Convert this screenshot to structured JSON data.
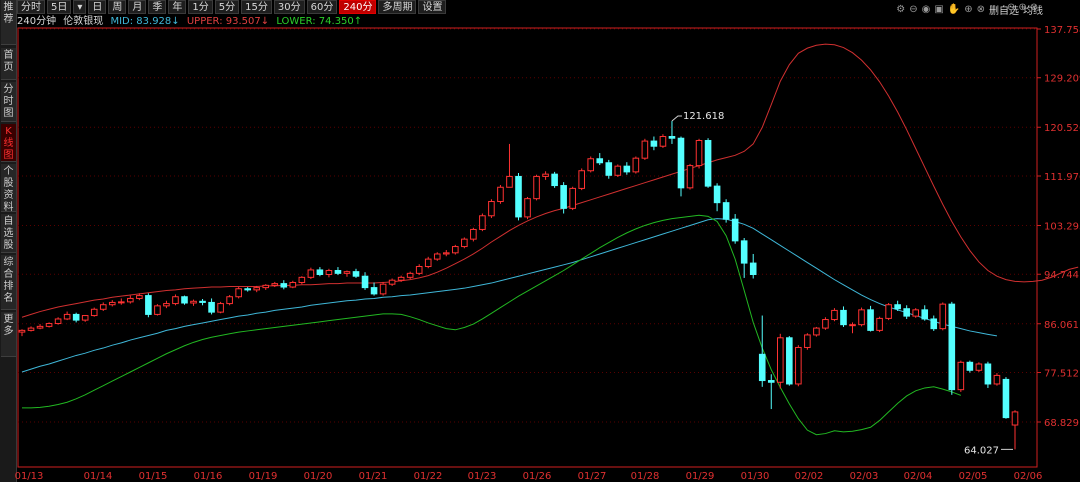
{
  "sidebar": {
    "items": [
      {
        "label": "推荐"
      },
      {
        "label": "首页"
      },
      {
        "label": "分时图"
      },
      {
        "label": "K线图",
        "active": true
      },
      {
        "label": "个股资料"
      },
      {
        "label": "自选股"
      },
      {
        "label": "综合排名"
      },
      {
        "label": "更多"
      }
    ]
  },
  "toolbar": {
    "items": [
      {
        "label": "分时"
      },
      {
        "label": "5日"
      },
      {
        "label": "▾"
      },
      {
        "label": "日"
      },
      {
        "label": "周"
      },
      {
        "label": "月"
      },
      {
        "label": "季"
      },
      {
        "label": "年"
      },
      {
        "label": "1分"
      },
      {
        "label": "5分"
      },
      {
        "label": "15分"
      },
      {
        "label": "30分"
      },
      {
        "label": "60分"
      },
      {
        "label": "240分",
        "active": true
      },
      {
        "label": "多周期"
      },
      {
        "label": "设置"
      }
    ]
  },
  "legend": {
    "period": "240分钟",
    "name": "伦敦银现",
    "mid": "MID: 83.928↓",
    "upper": "UPPER: 93.507↓",
    "lower": "LOWER: 74.350↑"
  },
  "right_tools": {
    "icons": [
      "settings-icon",
      "minus-icon",
      "eye-icon",
      "lock-icon",
      "hand-icon",
      "plus-icon",
      "close-icon"
    ],
    "labels": [
      "删自选",
      "均线"
    ],
    "right_icons": [
      "minus-icon",
      "plus-icon",
      "close-icon"
    ]
  },
  "colors": {
    "up": "#ff3232",
    "down": "#54ffff",
    "mid": "#3fb7d8",
    "upper": "#d03030",
    "lower": "#22b822",
    "axis": "#d02020"
  },
  "chart_data": {
    "type": "candlestick",
    "y_ticks": [
      "137.758",
      "129.209",
      "120.526",
      "111.976",
      "103.293",
      "94.744",
      "86.061",
      "77.512",
      "68.829"
    ],
    "x_labels": [
      "01/13",
      "01/14",
      "01/15",
      "01/16",
      "01/19",
      "01/20",
      "01/21",
      "01/22",
      "01/23",
      "01/26",
      "01/27",
      "01/28",
      "01/29",
      "01/30",
      "02/02",
      "02/03",
      "02/04",
      "02/05",
      "02/06"
    ],
    "annotations": [
      {
        "label": "121.618",
        "kind": "high"
      },
      {
        "label": "64.027",
        "kind": "low"
      }
    ],
    "candles": [
      [
        84.6,
        85.1,
        83.9,
        84.9
      ],
      [
        84.9,
        85.6,
        84.7,
        85.3
      ],
      [
        85.3,
        86.0,
        85.1,
        85.6
      ],
      [
        85.6,
        86.3,
        85.4,
        86.1
      ],
      [
        86.1,
        87.2,
        85.9,
        86.9
      ],
      [
        86.9,
        88.2,
        86.7,
        87.7
      ],
      [
        87.7,
        88.0,
        86.3,
        86.7
      ],
      [
        86.7,
        87.6,
        86.4,
        87.5
      ],
      [
        87.5,
        88.9,
        87.3,
        88.6
      ],
      [
        88.6,
        89.8,
        88.3,
        89.4
      ],
      [
        89.4,
        90.2,
        89.1,
        89.8
      ],
      [
        89.8,
        90.5,
        89.4,
        89.9
      ],
      [
        89.9,
        91.0,
        89.6,
        90.5
      ],
      [
        90.5,
        91.4,
        90.2,
        91.0
      ],
      [
        91.0,
        91.4,
        87.2,
        87.7
      ],
      [
        87.7,
        89.5,
        87.5,
        89.2
      ],
      [
        89.2,
        90.1,
        88.8,
        89.6
      ],
      [
        89.6,
        91.2,
        89.3,
        90.8
      ],
      [
        90.8,
        91.0,
        89.4,
        89.7
      ],
      [
        89.7,
        90.3,
        89.2,
        90.0
      ],
      [
        90.0,
        90.4,
        89.3,
        89.8
      ],
      [
        89.8,
        90.5,
        87.7,
        88.1
      ],
      [
        88.1,
        89.9,
        87.9,
        89.6
      ],
      [
        89.6,
        91.1,
        89.3,
        90.8
      ],
      [
        90.8,
        92.5,
        90.5,
        92.2
      ],
      [
        92.2,
        92.5,
        91.7,
        92.0
      ],
      [
        92.0,
        92.7,
        91.6,
        92.4
      ],
      [
        92.4,
        93.0,
        92.0,
        92.8
      ],
      [
        92.8,
        93.4,
        92.5,
        93.1
      ],
      [
        93.1,
        93.7,
        92.1,
        92.5
      ],
      [
        92.5,
        93.6,
        92.3,
        93.3
      ],
      [
        93.3,
        94.4,
        93.0,
        94.2
      ],
      [
        94.2,
        95.9,
        93.9,
        95.5
      ],
      [
        95.5,
        96.0,
        94.4,
        94.7
      ],
      [
        94.7,
        95.7,
        94.2,
        95.4
      ],
      [
        95.4,
        96.0,
        94.6,
        94.9
      ],
      [
        94.9,
        95.4,
        94.3,
        95.2
      ],
      [
        95.2,
        95.7,
        94.1,
        94.4
      ],
      [
        94.4,
        95.1,
        92.0,
        92.4
      ],
      [
        92.4,
        93.3,
        91.0,
        91.3
      ],
      [
        91.3,
        93.4,
        91.0,
        93.0
      ],
      [
        93.0,
        94.0,
        92.7,
        93.7
      ],
      [
        93.7,
        94.5,
        93.4,
        94.2
      ],
      [
        94.2,
        95.2,
        93.9,
        94.9
      ],
      [
        94.9,
        96.5,
        94.6,
        96.1
      ],
      [
        96.1,
        97.8,
        95.8,
        97.4
      ],
      [
        97.4,
        98.6,
        97.1,
        98.3
      ],
      [
        98.3,
        99.0,
        97.9,
        98.5
      ],
      [
        98.5,
        99.9,
        98.2,
        99.6
      ],
      [
        99.6,
        101.2,
        99.3,
        100.9
      ],
      [
        100.9,
        102.9,
        100.5,
        102.6
      ],
      [
        102.6,
        105.4,
        102.3,
        105.0
      ],
      [
        105.0,
        107.9,
        104.6,
        107.5
      ],
      [
        107.5,
        110.4,
        107.1,
        110.0
      ],
      [
        110.0,
        117.6,
        110.6,
        111.9
      ],
      [
        111.9,
        112.5,
        104.2,
        104.8
      ],
      [
        104.8,
        108.3,
        104.4,
        108.0
      ],
      [
        108.0,
        112.2,
        107.7,
        111.9
      ],
      [
        111.9,
        112.8,
        111.3,
        112.3
      ],
      [
        112.3,
        112.7,
        109.9,
        110.3
      ],
      [
        110.3,
        110.9,
        105.4,
        106.3
      ],
      [
        106.3,
        110.1,
        106.0,
        109.8
      ],
      [
        109.8,
        113.3,
        109.5,
        112.9
      ],
      [
        112.9,
        115.4,
        112.6,
        115.0
      ],
      [
        115.0,
        116.0,
        113.9,
        114.3
      ],
      [
        114.3,
        114.8,
        111.5,
        112.1
      ],
      [
        112.1,
        114.0,
        111.8,
        113.7
      ],
      [
        113.7,
        114.4,
        112.2,
        112.7
      ],
      [
        112.7,
        115.4,
        112.4,
        115.1
      ],
      [
        115.1,
        118.5,
        114.8,
        118.1
      ],
      [
        118.1,
        118.9,
        116.5,
        117.2
      ],
      [
        117.2,
        119.3,
        116.9,
        118.9
      ],
      [
        118.9,
        121.618,
        117.6,
        118.6
      ],
      [
        118.6,
        118.9,
        108.4,
        109.9
      ],
      [
        109.9,
        114.1,
        109.6,
        113.8
      ],
      [
        113.8,
        118.5,
        113.3,
        118.2
      ],
      [
        118.2,
        118.6,
        109.9,
        110.2
      ],
      [
        110.2,
        110.7,
        105.8,
        107.3
      ],
      [
        107.3,
        107.9,
        103.8,
        104.4
      ],
      [
        104.4,
        105.3,
        100.1,
        100.6
      ],
      [
        100.6,
        101.1,
        94.1,
        96.7
      ],
      [
        96.7,
        98.3,
        94.0,
        94.7
      ],
      [
        80.7,
        87.5,
        75.0,
        76.1
      ],
      [
        76.1,
        77.2,
        71.1,
        75.8
      ],
      [
        75.8,
        84.3,
        74.7,
        83.6
      ],
      [
        83.6,
        83.9,
        75.2,
        75.5
      ],
      [
        75.5,
        82.3,
        75.1,
        81.9
      ],
      [
        81.9,
        84.4,
        81.5,
        84.1
      ],
      [
        84.1,
        85.5,
        83.8,
        85.3
      ],
      [
        85.3,
        87.2,
        85.0,
        86.8
      ],
      [
        86.8,
        88.8,
        86.5,
        88.4
      ],
      [
        88.4,
        89.1,
        85.5,
        85.9
      ],
      [
        85.9,
        86.3,
        84.4,
        85.9
      ],
      [
        85.9,
        88.9,
        85.6,
        88.5
      ],
      [
        88.5,
        89.2,
        84.7,
        84.9
      ],
      [
        84.9,
        87.3,
        84.6,
        87.0
      ],
      [
        87.0,
        89.7,
        86.7,
        89.4
      ],
      [
        89.4,
        90.1,
        88.3,
        88.7
      ],
      [
        88.7,
        89.3,
        86.9,
        87.4
      ],
      [
        87.4,
        88.8,
        87.1,
        88.5
      ],
      [
        88.5,
        89.3,
        86.6,
        86.9
      ],
      [
        86.9,
        87.5,
        84.8,
        85.2
      ],
      [
        85.2,
        89.8,
        84.9,
        89.5
      ],
      [
        89.5,
        89.9,
        73.6,
        74.5
      ],
      [
        74.5,
        79.6,
        74.1,
        79.3
      ],
      [
        79.3,
        79.6,
        77.5,
        77.9
      ],
      [
        77.9,
        79.3,
        77.6,
        79.0
      ],
      [
        79.0,
        79.4,
        74.8,
        75.5
      ],
      [
        75.5,
        77.4,
        75.2,
        77.0
      ],
      [
        76.3,
        76.7,
        69.4,
        69.6
      ],
      [
        68.3,
        70.9,
        64.027,
        70.6
      ]
    ],
    "mid": [
      77.6,
      78.1,
      78.6,
      79.0,
      79.5,
      80.0,
      80.5,
      80.9,
      81.4,
      81.8,
      82.3,
      82.7,
      83.2,
      83.6,
      84.0,
      84.4,
      84.9,
      85.2,
      85.6,
      85.9,
      86.2,
      86.5,
      86.8,
      87.1,
      87.4,
      87.6,
      87.9,
      88.1,
      88.4,
      88.6,
      88.8,
      89.0,
      89.3,
      89.5,
      89.7,
      89.9,
      90.1,
      90.2,
      90.4,
      90.5,
      90.7,
      90.8,
      91.0,
      91.1,
      91.3,
      91.5,
      91.7,
      91.9,
      92.1,
      92.3,
      92.6,
      92.9,
      93.2,
      93.6,
      94.0,
      94.4,
      94.8,
      95.2,
      95.6,
      96.0,
      96.4,
      96.8,
      97.3,
      97.8,
      98.3,
      98.8,
      99.3,
      99.8,
      100.3,
      100.8,
      101.3,
      101.8,
      102.3,
      102.8,
      103.3,
      103.8,
      104.3,
      104.5,
      104.4,
      104.0,
      103.5,
      102.8,
      101.8,
      100.8,
      99.8,
      98.8,
      97.8,
      96.8,
      95.8,
      94.8,
      93.8,
      92.9,
      92.0,
      91.1,
      90.3,
      89.6,
      89.0,
      88.5,
      88.0,
      87.5,
      87.0,
      86.5,
      86.0,
      85.6,
      85.2,
      84.8,
      84.5,
      84.2,
      83.93
    ],
    "upper": [
      87.2,
      87.7,
      88.2,
      88.6,
      89.0,
      89.3,
      89.6,
      89.9,
      90.2,
      90.4,
      90.7,
      90.9,
      91.1,
      91.3,
      91.5,
      91.7,
      91.9,
      92.0,
      92.2,
      92.3,
      92.4,
      92.5,
      92.5,
      92.6,
      92.6,
      92.6,
      92.6,
      92.7,
      92.7,
      92.8,
      92.8,
      92.9,
      92.9,
      93.0,
      93.1,
      93.1,
      93.2,
      93.2,
      93.2,
      93.2,
      93.3,
      93.4,
      93.6,
      93.8,
      94.1,
      94.5,
      95.1,
      95.8,
      96.6,
      97.4,
      98.3,
      99.3,
      100.4,
      101.4,
      102.4,
      103.3,
      104.1,
      104.8,
      105.4,
      105.9,
      106.3,
      106.8,
      107.3,
      107.8,
      108.3,
      108.8,
      109.3,
      109.8,
      110.3,
      110.8,
      111.3,
      111.8,
      112.3,
      112.8,
      113.3,
      113.8,
      114.3,
      114.8,
      115.2,
      115.6,
      116.3,
      117.6,
      120.5,
      124.5,
      128.6,
      131.5,
      133.5,
      134.4,
      134.9,
      135.1,
      135.0,
      134.5,
      133.6,
      132.3,
      130.6,
      128.5,
      126.0,
      123.2,
      120.1,
      116.8,
      113.5,
      110.2,
      107.0,
      104.0,
      101.3,
      98.9,
      96.9,
      95.4,
      94.4,
      93.8,
      93.5,
      93.4,
      93.5,
      93.7,
      94.2,
      94.9,
      95.6,
      96.0
    ],
    "lower": [
      71.3,
      71.3,
      71.4,
      71.6,
      71.9,
      72.3,
      72.9,
      73.6,
      74.4,
      75.2,
      76.0,
      76.8,
      77.6,
      78.4,
      79.2,
      80.0,
      80.8,
      81.5,
      82.2,
      82.8,
      83.3,
      83.7,
      84.0,
      84.3,
      84.6,
      84.8,
      85.0,
      85.2,
      85.4,
      85.6,
      85.8,
      86.0,
      86.2,
      86.4,
      86.6,
      86.8,
      87.0,
      87.2,
      87.4,
      87.6,
      87.8,
      87.8,
      87.7,
      87.3,
      86.8,
      86.2,
      85.7,
      85.2,
      85.0,
      85.4,
      86.0,
      86.9,
      87.9,
      88.9,
      89.9,
      90.9,
      91.8,
      92.7,
      93.6,
      94.5,
      95.4,
      96.4,
      97.4,
      98.4,
      99.4,
      100.3,
      101.2,
      102.0,
      102.7,
      103.3,
      103.8,
      104.2,
      104.5,
      104.7,
      104.9,
      105.1,
      104.9,
      104.0,
      101.5,
      97.4,
      91.9,
      86.3,
      81.8,
      78.0,
      74.9,
      72.0,
      69.4,
      67.4,
      66.6,
      66.8,
      67.3,
      67.1,
      67.2,
      67.5,
      67.9,
      69.1,
      70.6,
      72.1,
      73.4,
      74.3,
      74.8,
      75.0,
      74.6,
      74.1,
      73.5
    ]
  }
}
